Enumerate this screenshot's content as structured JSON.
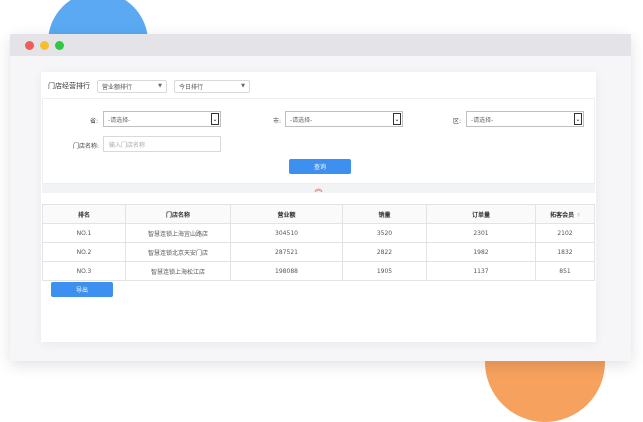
{
  "header": {
    "title": "门店经营排行",
    "metric_select": "营业额排行",
    "period_select": "今日排行"
  },
  "filters": {
    "province_label": "省:",
    "province_value": "-请选择-",
    "city_label": "市:",
    "city_value": "-请选择-",
    "district_label": "区:",
    "district_value": "-请选择-",
    "store_label": "门店名称:",
    "store_placeholder": "输入门店名称",
    "search_label": "查询"
  },
  "table": {
    "headers": [
      "排名",
      "门店名称",
      "营业额",
      "销量",
      "订单量",
      "拓客会员"
    ],
    "rows": [
      [
        "NO.1",
        "智慧连锁上海宜山路店",
        "304510",
        "3520",
        "2301",
        "2102"
      ],
      [
        "NO.2",
        "智慧连锁北京天安门店",
        "287521",
        "2822",
        "1982",
        "1832"
      ],
      [
        "NO.3",
        "智慧连锁上海松江店",
        "198088",
        "1905",
        "1137",
        "851"
      ]
    ]
  },
  "actions": {
    "export_label": "导出"
  },
  "colors": {
    "primary": "#3d8ff0",
    "collapse_icon": "#e0473d"
  }
}
